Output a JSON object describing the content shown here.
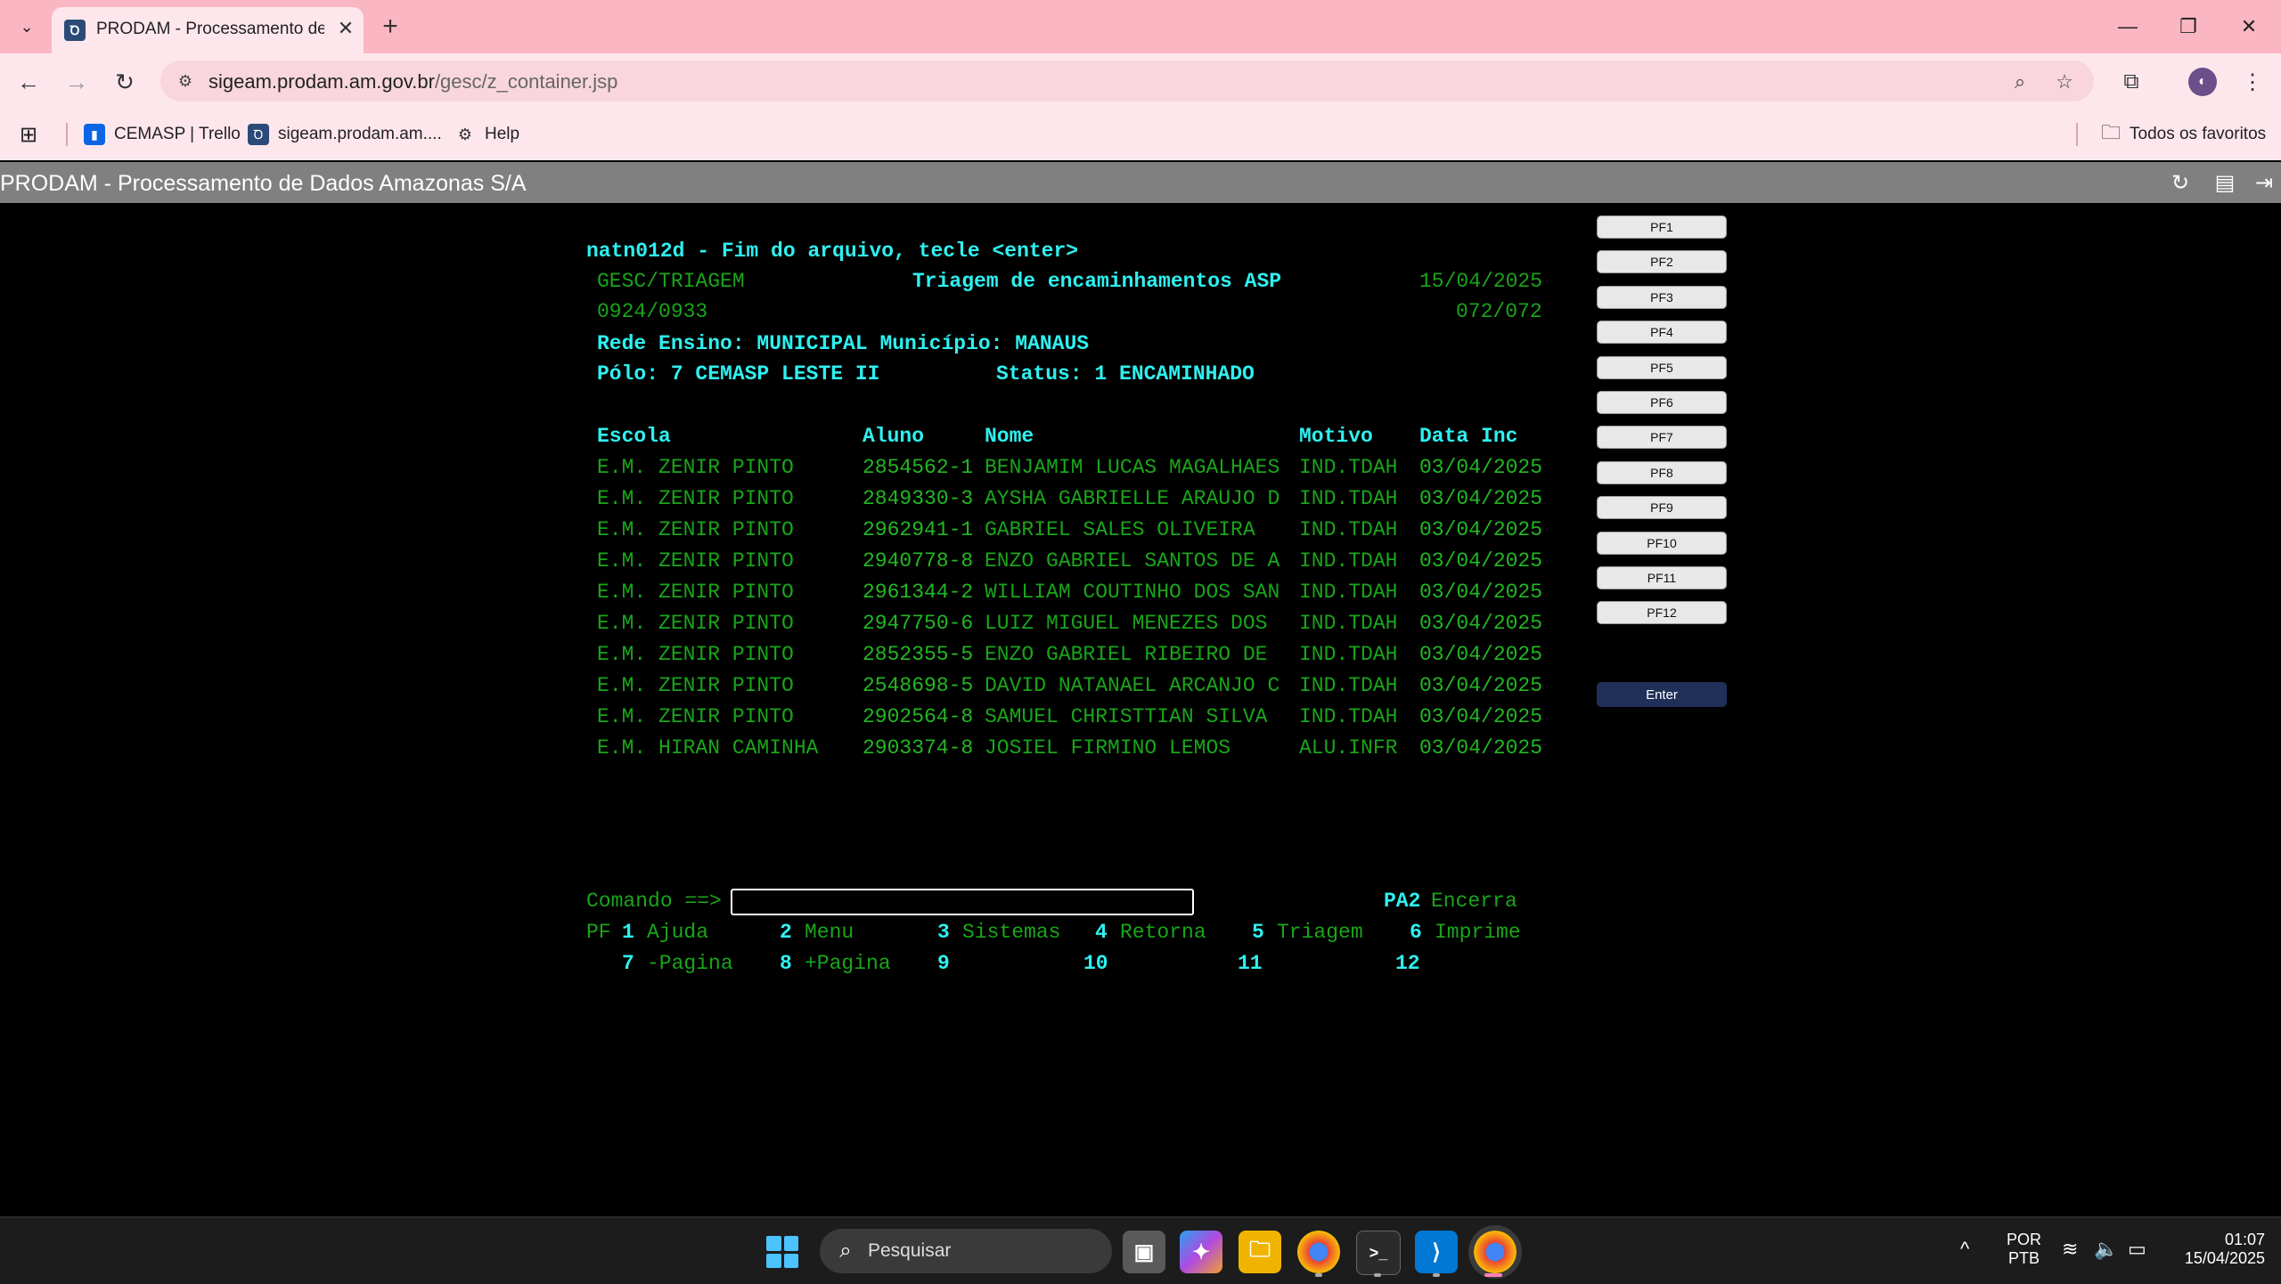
{
  "browser": {
    "tab_title": "PRODAM - Processamento de Dados Amazonas S/A",
    "url_host": "sigeam.prodam.am.gov.br",
    "url_path": "/gesc/z_container.jsp",
    "bookmarks": [
      {
        "label": "CEMASP | Trello"
      },
      {
        "label": "sigeam.prodam.am...."
      },
      {
        "label": "Help"
      }
    ],
    "all_bookmarks_label": "Todos os favoritos"
  },
  "app": {
    "header_title": "PRODAM - Processamento de Dados Amazonas S/A"
  },
  "screen": {
    "message": "natn012d - Fim do arquivo, tecle <enter>",
    "system_path": "GESC/TRIAGEM",
    "screen_title": "Triagem de encaminhamentos ASP",
    "date": "15/04/2025",
    "time_range": "0924/0933",
    "page_counter": "072/072",
    "rede_line": "Rede Ensino: MUNICIPAL Município: MANAUS",
    "polo_line": "Pólo: 7 CEMASP LESTE II",
    "status_line": "Status: 1 ENCAMINHADO",
    "columns": {
      "escola": "Escola",
      "aluno": "Aluno",
      "nome": "Nome",
      "motivo": "Motivo",
      "data_inc": "Data Inc"
    },
    "rows": [
      {
        "escola": "E.M. ZENIR PINTO",
        "aluno": "2854562-1",
        "nome": "BENJAMIM LUCAS MAGALHAES",
        "motivo": "IND.TDAH",
        "data": "03/04/2025"
      },
      {
        "escola": "E.M. ZENIR PINTO",
        "aluno": "2849330-3",
        "nome": "AYSHA GABRIELLE ARAUJO D",
        "motivo": "IND.TDAH",
        "data": "03/04/2025"
      },
      {
        "escola": "E.M. ZENIR PINTO",
        "aluno": "2962941-1",
        "nome": "GABRIEL SALES OLIVEIRA",
        "motivo": "IND.TDAH",
        "data": "03/04/2025"
      },
      {
        "escola": "E.M. ZENIR PINTO",
        "aluno": "2940778-8",
        "nome": "ENZO GABRIEL SANTOS DE A",
        "motivo": "IND.TDAH",
        "data": "03/04/2025"
      },
      {
        "escola": "E.M. ZENIR PINTO",
        "aluno": "2961344-2",
        "nome": "WILLIAM COUTINHO DOS SAN",
        "motivo": "IND.TDAH",
        "data": "03/04/2025"
      },
      {
        "escola": "E.M. ZENIR PINTO",
        "aluno": "2947750-6",
        "nome": "LUIZ MIGUEL MENEZES DOS",
        "motivo": "IND.TDAH",
        "data": "03/04/2025"
      },
      {
        "escola": "E.M. ZENIR PINTO",
        "aluno": "2852355-5",
        "nome": "ENZO GABRIEL RIBEIRO DE",
        "motivo": "IND.TDAH",
        "data": "03/04/2025"
      },
      {
        "escola": "E.M. ZENIR PINTO",
        "aluno": "2548698-5",
        "nome": "DAVID NATANAEL ARCANJO C",
        "motivo": "IND.TDAH",
        "data": "03/04/2025"
      },
      {
        "escola": "E.M. ZENIR PINTO",
        "aluno": "2902564-8",
        "nome": "SAMUEL CHRISTTIAN SILVA",
        "motivo": "IND.TDAH",
        "data": "03/04/2025"
      },
      {
        "escola": "E.M. HIRAN CAMINHA",
        "aluno": "2903374-8",
        "nome": "JOSIEL FIRMINO LEMOS",
        "motivo": "ALU.INFR",
        "data": "03/04/2025"
      }
    ],
    "command_label": "Comando ==>",
    "command_value": "",
    "pa2_key": "PA2",
    "pa2_label": "Encerra",
    "pf_prefix": "PF",
    "pf_row1": [
      {
        "key": "1",
        "label": "Ajuda"
      },
      {
        "key": "2",
        "label": "Menu"
      },
      {
        "key": "3",
        "label": "Sistemas"
      },
      {
        "key": "4",
        "label": "Retorna"
      },
      {
        "key": "5",
        "label": "Triagem"
      },
      {
        "key": "6",
        "label": "Imprime"
      }
    ],
    "pf_row2": [
      {
        "key": "7",
        "label": "-Pagina"
      },
      {
        "key": "8",
        "label": "+Pagina"
      },
      {
        "key": "9",
        "label": ""
      },
      {
        "key": "10",
        "label": ""
      },
      {
        "key": "11",
        "label": ""
      },
      {
        "key": "12",
        "label": ""
      }
    ]
  },
  "pf_buttons": [
    "PF1",
    "PF2",
    "PF3",
    "PF4",
    "PF5",
    "PF6",
    "PF7",
    "PF8",
    "PF9",
    "PF10",
    "PF11",
    "PF12"
  ],
  "enter_button": "Enter",
  "taskbar": {
    "search_placeholder": "Pesquisar",
    "language_top": "POR",
    "language_bottom": "PTB",
    "time": "01:07",
    "date": "15/04/2025"
  },
  "icons": [
    "tab-list-icon",
    "favicon-icon",
    "close-icon",
    "plus-icon",
    "minimize-icon",
    "restore-icon",
    "back-icon",
    "forward-icon",
    "reload-icon",
    "site-info-icon",
    "zoom-icon",
    "star-icon",
    "extensions-icon",
    "avatar-icon",
    "more-icon",
    "apps-icon",
    "trello-icon",
    "help-icon",
    "folder-icon",
    "refresh-icon",
    "document-icon",
    "exit-icon",
    "windows-icon",
    "search-icon",
    "wifi-icon",
    "volume-icon",
    "battery-icon",
    "chevron-up-icon"
  ],
  "colors": {
    "chrome_pink": "#fbb6c3",
    "terminal_cyan": "#2ff0f0",
    "terminal_green": "#1aa51a",
    "enter_button": "#1f2f57"
  }
}
